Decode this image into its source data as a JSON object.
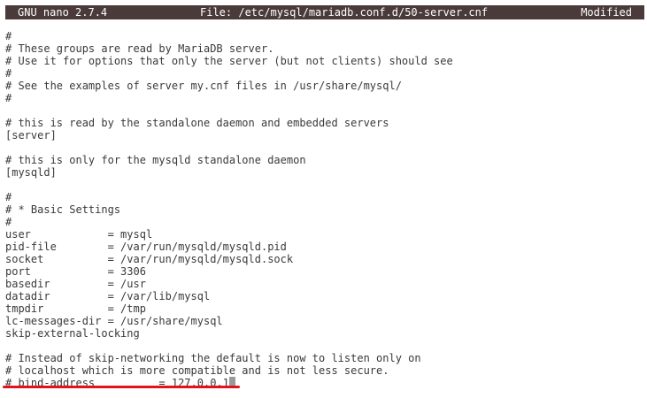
{
  "titlebar": {
    "app": "GNU nano 2.7.4",
    "file": "File: /etc/mysql/mariadb.conf.d/50-server.cnf",
    "status": "Modified"
  },
  "lines": [
    "#",
    "# These groups are read by MariaDB server.",
    "# Use it for options that only the server (but not clients) should see",
    "#",
    "# See the examples of server my.cnf files in /usr/share/mysql/",
    "#",
    "",
    "# this is read by the standalone daemon and embedded servers",
    "[server]",
    "",
    "# this is only for the mysqld standalone daemon",
    "[mysqld]",
    "",
    "#",
    "# * Basic Settings",
    "#",
    "user            = mysql",
    "pid-file        = /var/run/mysqld/mysqld.pid",
    "socket          = /var/run/mysqld/mysqld.sock",
    "port            = 3306",
    "basedir         = /usr",
    "datadir         = /var/lib/mysql",
    "tmpdir          = /tmp",
    "lc-messages-dir = /usr/share/mysql",
    "skip-external-locking",
    "",
    "# Instead of skip-networking the default is now to listen only on",
    "# localhost which is more compatible and is not less secure.",
    "# bind-address          = 127.0.0.1"
  ],
  "colors": {
    "titlebar_bg": "#4a3a3a",
    "highlight": "#e0141c"
  }
}
